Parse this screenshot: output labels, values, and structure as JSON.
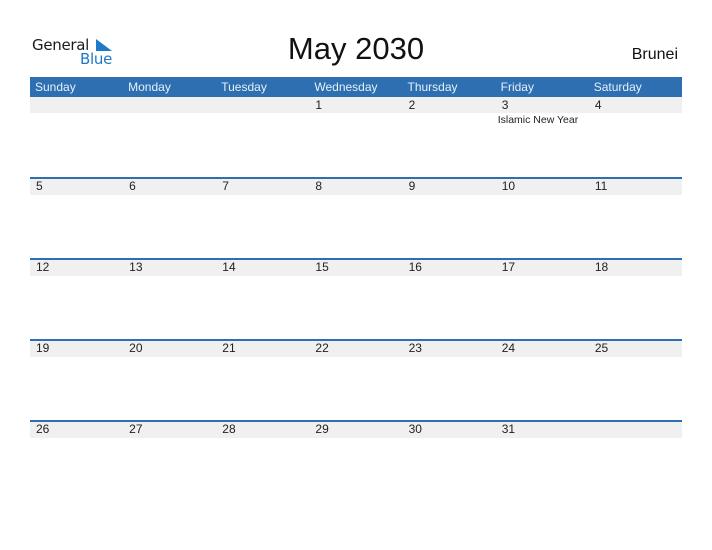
{
  "logo": {
    "line1": "General",
    "line2": "Blue"
  },
  "title": "May 2030",
  "country": "Brunei",
  "colors": {
    "accent": "#2e6fb2",
    "day_band": "#f0f0f0",
    "logo_blue": "#1f79c4"
  },
  "weekdays": [
    "Sunday",
    "Monday",
    "Tuesday",
    "Wednesday",
    "Thursday",
    "Friday",
    "Saturday"
  ],
  "weeks": [
    [
      {
        "day": ""
      },
      {
        "day": ""
      },
      {
        "day": ""
      },
      {
        "day": "1"
      },
      {
        "day": "2"
      },
      {
        "day": "3",
        "event": "Islamic New Year"
      },
      {
        "day": "4"
      }
    ],
    [
      {
        "day": "5"
      },
      {
        "day": "6"
      },
      {
        "day": "7"
      },
      {
        "day": "8"
      },
      {
        "day": "9"
      },
      {
        "day": "10"
      },
      {
        "day": "11"
      }
    ],
    [
      {
        "day": "12"
      },
      {
        "day": "13"
      },
      {
        "day": "14"
      },
      {
        "day": "15"
      },
      {
        "day": "16"
      },
      {
        "day": "17"
      },
      {
        "day": "18"
      }
    ],
    [
      {
        "day": "19"
      },
      {
        "day": "20"
      },
      {
        "day": "21"
      },
      {
        "day": "22"
      },
      {
        "day": "23"
      },
      {
        "day": "24"
      },
      {
        "day": "25"
      }
    ],
    [
      {
        "day": "26"
      },
      {
        "day": "27"
      },
      {
        "day": "28"
      },
      {
        "day": "29"
      },
      {
        "day": "30"
      },
      {
        "day": "31"
      },
      {
        "day": ""
      }
    ]
  ]
}
